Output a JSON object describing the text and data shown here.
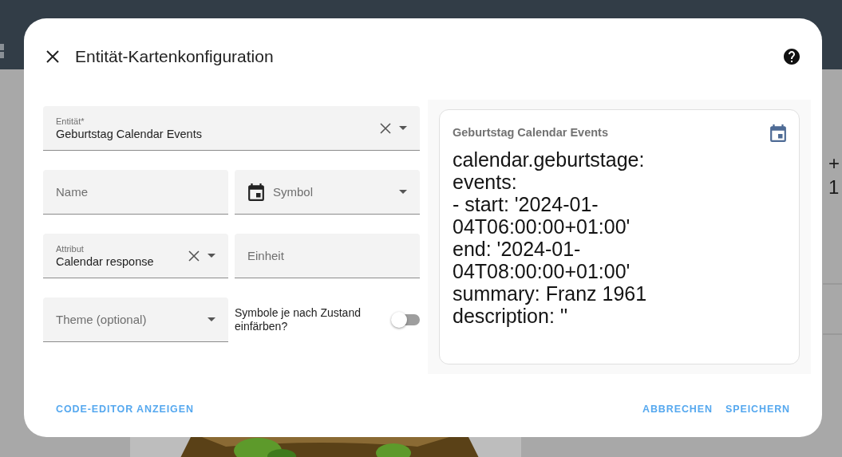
{
  "background": {
    "card_texts": [
      "+",
      "1"
    ]
  },
  "window": {
    "title": "Entität-Kartenkonfiguration"
  },
  "form": {
    "fields": [
      {
        "kind": "select",
        "label": "Entität*",
        "value": "Geburtstag Calendar Events",
        "clearable": true,
        "wide": true
      },
      {
        "kind": "text",
        "label": "Name",
        "wide": false
      },
      {
        "kind": "icon-select",
        "label": "Symbol",
        "wide": false
      },
      {
        "kind": "select",
        "label": "Attribut",
        "value": "Calendar response",
        "clearable": true,
        "wide": false
      },
      {
        "kind": "text",
        "label": "Einheit",
        "wide": false
      },
      {
        "kind": "select",
        "label": "Theme (optional)",
        "clearable": false,
        "wide": false
      },
      {
        "kind": "toggle",
        "label": "Symbole je nach Zustand einfärben?",
        "on": false,
        "wide": false
      }
    ]
  },
  "preview": {
    "title": "Geburtstag Calendar Events",
    "state": "calendar.geburtstage:\nevents:\n- start: '2024-01-\n04T06:00:00+01:00'\nend: '2024-01-\n04T08:00:00+01:00'\nsummary: Franz 1961\ndescription: ''"
  },
  "footer": {
    "left_buttons": [
      {
        "label": "CODE-EDITOR ANZEIGEN"
      }
    ],
    "right_buttons": [
      {
        "label": "ABBRECHEN"
      },
      {
        "label": "SPEICHERN"
      }
    ]
  }
}
